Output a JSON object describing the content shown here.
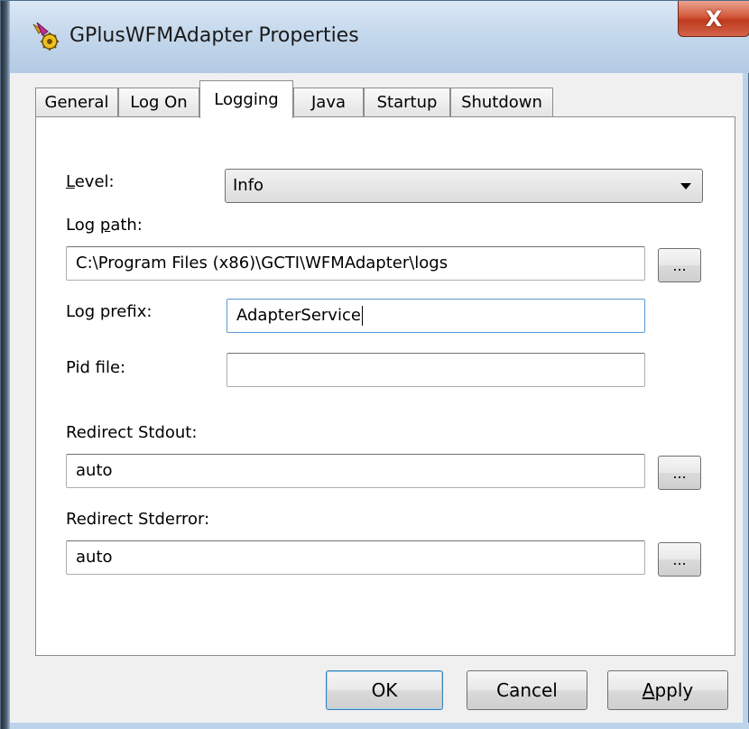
{
  "window": {
    "title": "GPlusWFMAdapter Properties",
    "close_label": "X"
  },
  "tabs": [
    {
      "label": "General",
      "active": false
    },
    {
      "label": "Log On",
      "active": false
    },
    {
      "label": "Logging",
      "active": true
    },
    {
      "label": "Java",
      "active": false
    },
    {
      "label": "Startup",
      "active": false
    },
    {
      "label": "Shutdown",
      "active": false
    }
  ],
  "logging": {
    "level": {
      "label_prefix": "L",
      "label_rest": "evel:",
      "value": "Info"
    },
    "log_path": {
      "label_prefix": "Log ",
      "label_mnemonic": "p",
      "label_rest": "ath:",
      "value": "C:\\Program Files (x86)\\GCTI\\WFMAdapter\\logs"
    },
    "log_prefix": {
      "label": "Log prefix:",
      "value": "AdapterService"
    },
    "pid_file": {
      "label": "Pid file:",
      "value": ""
    },
    "redirect_stdout": {
      "label": "Redirect Stdout:",
      "value": "auto"
    },
    "redirect_stderror": {
      "label": "Redirect Stderror:",
      "value": "auto"
    },
    "browse_label": "..."
  },
  "buttons": {
    "ok": "OK",
    "cancel": "Cancel",
    "apply_mnemonic": "A",
    "apply_rest": "pply"
  },
  "colors": {
    "titlebar": "#c5d8ec",
    "close_button": "#d4583b",
    "dialog_background": "#f0f0f0",
    "focus_border": "#5b9bd5"
  }
}
